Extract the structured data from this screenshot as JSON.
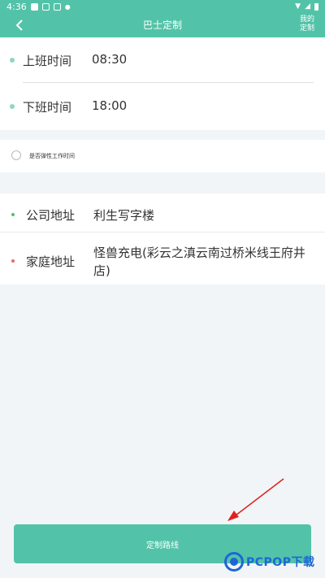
{
  "status_bar": {
    "time": "4:36"
  },
  "app_bar": {
    "title": "巴士定制",
    "mine_label": "我的\n定制"
  },
  "work_time": {
    "start": {
      "label": "上班时间",
      "value": "08:30"
    },
    "end": {
      "label": "下班时间",
      "value": "18:00"
    }
  },
  "flex": {
    "label": "是否弹性工作时间",
    "checked": false
  },
  "address": {
    "company": {
      "label": "公司地址",
      "value": "利生写字楼"
    },
    "home": {
      "label": "家庭地址",
      "value": "怪兽充电(彩云之滇云南过桥米线王府井店)"
    }
  },
  "submit_label": "定制路线",
  "watermark": {
    "text": "PCPOP下载"
  },
  "colors": {
    "accent": "#52c3a8",
    "time_dot": "#8fd6c6",
    "company_dot": "#4cbf7a",
    "home_dot": "#e56a6a",
    "arrow": "#e02020"
  }
}
